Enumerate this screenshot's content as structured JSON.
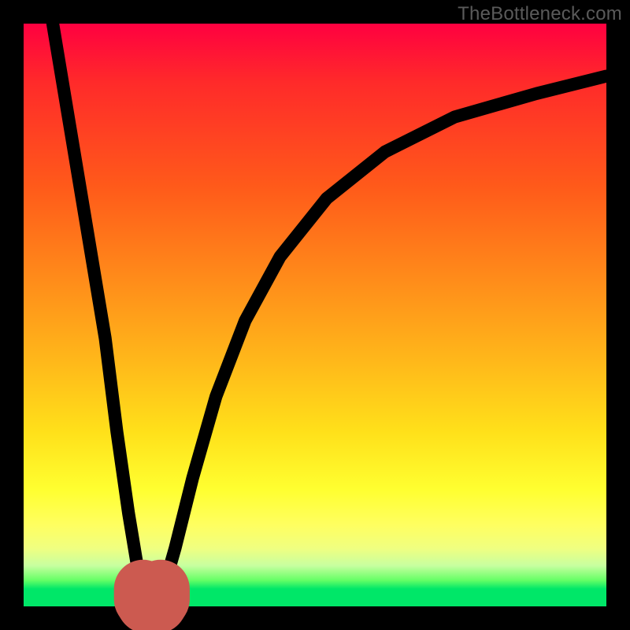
{
  "watermark": "TheBottleneck.com",
  "chart_data": {
    "type": "line",
    "title": "",
    "xlabel": "",
    "ylabel": "",
    "xlim": [
      0,
      100
    ],
    "ylim": [
      0,
      100
    ],
    "grid": false,
    "legend": false,
    "series": [
      {
        "name": "curve-left",
        "x": [
          5,
          8,
          11,
          14,
          16,
          18,
          19.5,
          20.5,
          21
        ],
        "y": [
          100,
          82,
          64,
          46,
          30,
          16,
          7,
          2.5,
          0.5
        ]
      },
      {
        "name": "curve-right",
        "x": [
          23,
          24,
          26,
          29,
          33,
          38,
          44,
          52,
          62,
          74,
          88,
          100
        ],
        "y": [
          0.5,
          3,
          10,
          22,
          36,
          49,
          60,
          70,
          78,
          84,
          88,
          91
        ]
      }
    ],
    "marker": {
      "name": "u-marker",
      "path_x": [
        20.5,
        20.5,
        21,
        22,
        23,
        23.5,
        23.5
      ],
      "path_y": [
        3,
        1.2,
        0.4,
        0.2,
        0.4,
        1.2,
        3
      ],
      "color": "#cc5a50"
    }
  }
}
